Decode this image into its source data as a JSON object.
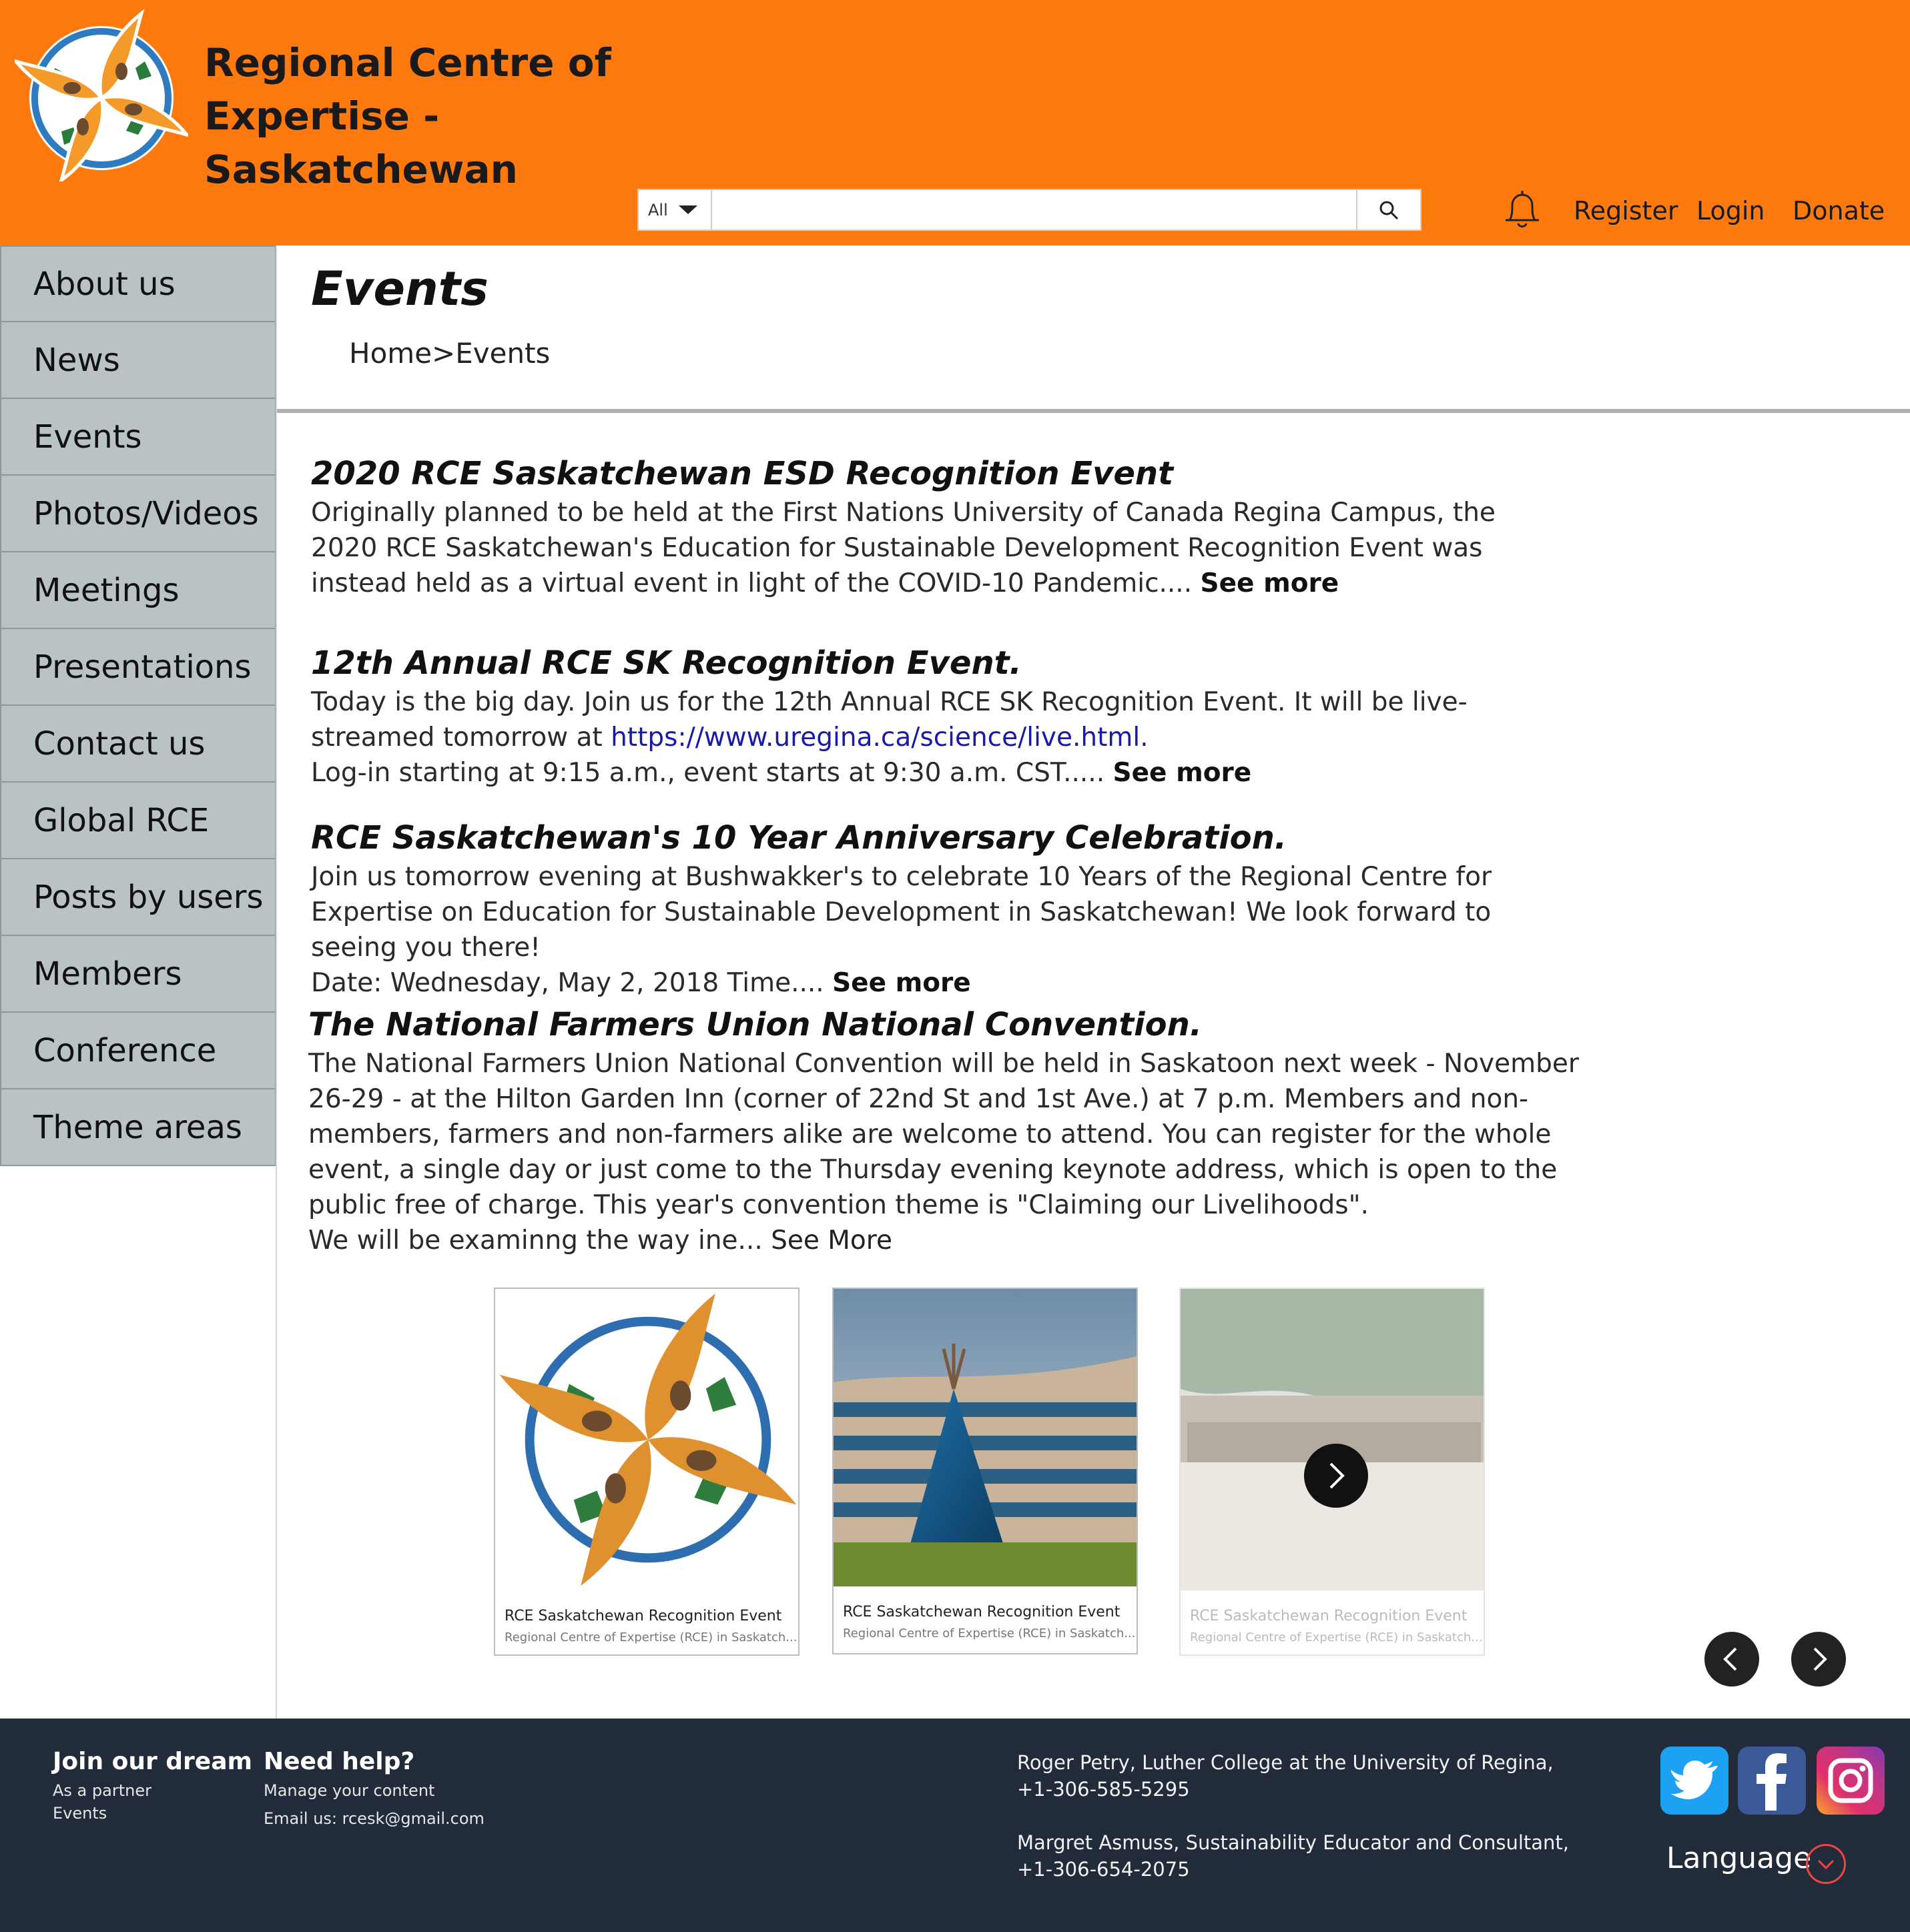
{
  "header": {
    "title_line1": "Regional Centre of Expertise -",
    "title_line2": "Saskatchewan",
    "search": {
      "scope": "All",
      "placeholder": ""
    },
    "links": {
      "register": "Register",
      "login": "Login",
      "donate": "Donate"
    }
  },
  "sidebar": {
    "items": [
      {
        "label": "About us"
      },
      {
        "label": "News"
      },
      {
        "label": "Events"
      },
      {
        "label": "Photos/Videos"
      },
      {
        "label": "Meetings"
      },
      {
        "label": "Presentations"
      },
      {
        "label": "Contact us"
      },
      {
        "label": "Global RCE"
      },
      {
        "label": "Posts by users"
      },
      {
        "label": "Members"
      },
      {
        "label": "Conference"
      },
      {
        "label": "Theme areas"
      }
    ]
  },
  "main": {
    "title": "Events",
    "breadcrumb": {
      "home": "Home",
      "sep": ">",
      "current": "Events"
    },
    "events": [
      {
        "title": "2020 RCE Saskatchewan ESD Recognition Event",
        "body": "Originally planned to be held at the First Nations University of Canada Regina Campus, the 2020 RCE Saskatchewan's Education for Sustainable Development Recognition Event was instead held as a virtual event in light of the COVID-10 Pandemic.... ",
        "more": "See more"
      },
      {
        "title": "12th Annual RCE SK Recognition Event.",
        "body": "Today is the big day. Join us for the 12th Annual RCE SK Recognition Event. It will be live-streamed tomorrow at ",
        "link": "https://www.uregina.ca/science/live.html.",
        "body2": "Log-in starting at 9:15 a.m., event starts at 9:30 a.m. CST..... ",
        "more": "See more"
      },
      {
        "title": "RCE Saskatchewan's 10 Year Anniversary Celebration.",
        "body": "Join us tomorrow evening at Bushwakker's to celebrate 10 Years of the Regional Centre for Expertise on Education for Sustainable Development in Saskatchewan! We look forward to seeing you there!",
        "body2": "Date: Wednesday, May 2, 2018 Time.... ",
        "more": "See more"
      },
      {
        "title": "The National Farmers Union National Convention.",
        "body": "The National Farmers Union National Convention will be held in Saskatoon next week - November 26-29 - at the Hilton Garden Inn (corner of 22nd St and 1st Ave.) at 7 p.m. Members and non-members, farmers and non-farmers alike are welcome to attend. You can register for the whole event, a single day or just come to the Thursday evening keynote address, which is open to the public free of charge. This year's convention theme is \"Claiming our Livelihoods\".",
        "body2": "We will be examinng the way ine... ",
        "more": "See More"
      }
    ],
    "cards": [
      {
        "title": "RCE Saskatchewan Recognition Event",
        "subtitle": "Regional Centre of Expertise (RCE) in Saskatch..."
      },
      {
        "title": "RCE Saskatchewan Recognition Event",
        "subtitle": "Regional Centre of Expertise (RCE) in Saskatch..."
      },
      {
        "title": "RCE Saskatchewan Recognition Event",
        "subtitle": "Regional Centre of Expertise (RCE) in Saskatch..."
      }
    ]
  },
  "footer": {
    "join": {
      "heading": "Join our dream",
      "links": [
        "As a partner",
        "Events"
      ]
    },
    "help": {
      "heading": "Need help?",
      "links": [
        "Manage your content",
        "Email us: rcesk@gmail.com"
      ]
    },
    "contacts": [
      {
        "name": "Roger Petry, Luther College at the University of Regina,",
        "phone": "+1-306-585-5295"
      },
      {
        "name": "Margret Asmuss, Sustainability Educator and Consultant,",
        "phone": "+1-306-654-2075"
      }
    ],
    "language": "Language"
  },
  "colors": {
    "header_bg": "#ff7a0e",
    "sidebar_bg": "#b9c2c4",
    "footer_bg": "#222b39",
    "link": "#1a1aa8"
  },
  "icons": [
    "rce-logo-icon",
    "caret-down-icon",
    "search-icon",
    "bell-icon",
    "play-icon",
    "chevron-left-icon",
    "chevron-right-icon",
    "twitter-icon",
    "facebook-icon",
    "instagram-icon",
    "chevron-down-icon"
  ]
}
